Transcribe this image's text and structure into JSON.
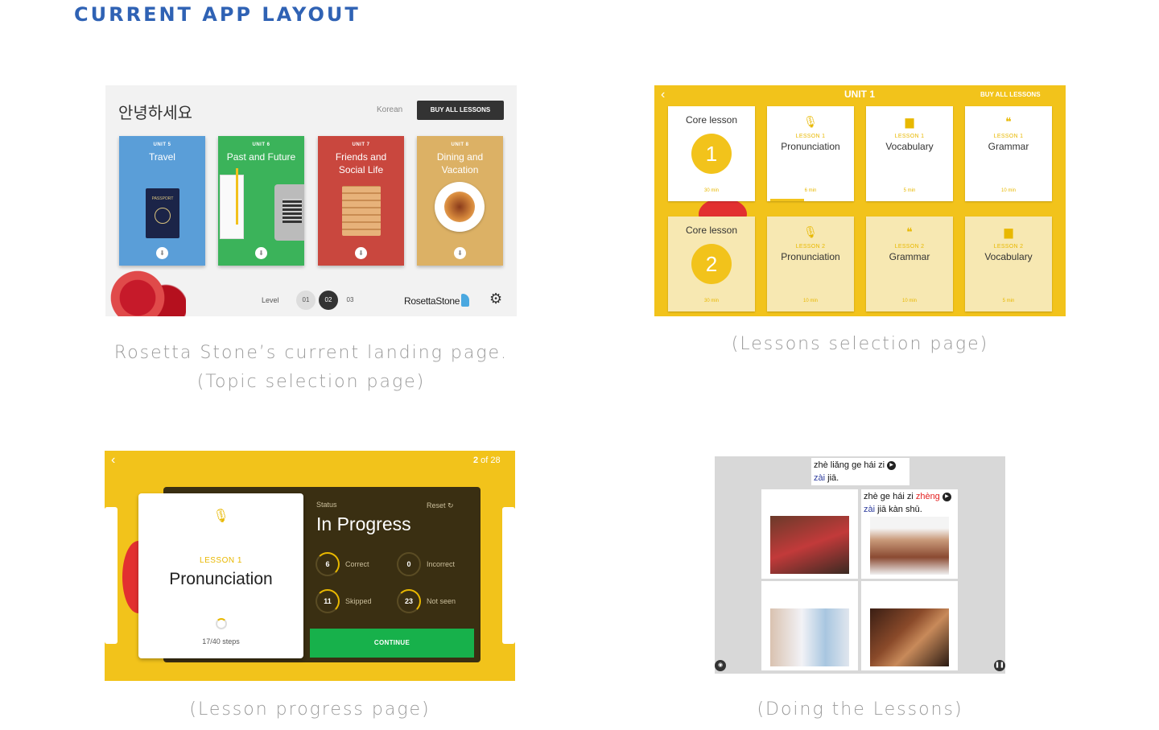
{
  "page_title": "CURRENT APP LAYOUT",
  "captions": {
    "landing_line1": "Rosetta Stone’s current landing page.",
    "landing_line2": "(Topic selection page)",
    "lessons": "(Lessons selection page)",
    "progress": "(Lesson progress page)",
    "doing": "(Doing the Lessons)"
  },
  "landing": {
    "greeting": "안녕하세요",
    "language": "Korean",
    "buy_button": "BUY ALL LESSONS",
    "units": [
      {
        "number": "UNIT 5",
        "title": "Travel",
        "color": "#5a9ed8"
      },
      {
        "number": "UNIT 6",
        "title": "Past and Future",
        "color": "#3bb35a"
      },
      {
        "number": "UNIT 7",
        "title": "Friends and Social Life",
        "color": "#c9473e"
      },
      {
        "number": "UNIT 8",
        "title": "Dining and Vacation",
        "color": "#dcb165"
      }
    ],
    "passport_text": "PASSPORT",
    "level_label": "Level",
    "levels": [
      "01",
      "02",
      "03"
    ],
    "selected_level": "02",
    "brand": "RosettaStone"
  },
  "lessons": {
    "unit_title": "UNIT 1",
    "buy_button": "BUY ALL LESSONS",
    "row1": [
      {
        "type": "core",
        "title": "Core lesson",
        "number": "1",
        "duration": "30 min"
      },
      {
        "icon": "microphone-icon",
        "sub": "LESSON 1",
        "name": "Pronunciation",
        "duration": "6 min"
      },
      {
        "icon": "book-icon",
        "sub": "LESSON 1",
        "name": "Vocabulary",
        "duration": "5 min"
      },
      {
        "icon": "quote-icon",
        "sub": "LESSON 1",
        "name": "Grammar",
        "duration": "10 min"
      }
    ],
    "row2": [
      {
        "type": "core",
        "title": "Core lesson",
        "number": "2",
        "duration": "30 min"
      },
      {
        "icon": "microphone-icon",
        "sub": "LESSON 2",
        "name": "Pronunciation",
        "duration": "10 min"
      },
      {
        "icon": "quote-icon",
        "sub": "LESSON 2",
        "name": "Grammar",
        "duration": "10 min"
      },
      {
        "icon": "book-icon",
        "sub": "LESSON 2",
        "name": "Vocabulary",
        "duration": "5 min"
      }
    ]
  },
  "progress": {
    "counter_current": "2",
    "counter_rest": " of 28",
    "lesson_label": "LESSON 1",
    "lesson_name": "Pronunciation",
    "steps": "17/40 steps",
    "status_label": "Status",
    "reset_label": "Reset",
    "status_value": "In Progress",
    "stats": [
      {
        "value": "6",
        "label": "Correct"
      },
      {
        "value": "0",
        "label": "Incorrect"
      },
      {
        "value": "11",
        "label": "Skipped"
      },
      {
        "value": "23",
        "label": "Not seen"
      }
    ],
    "continue_button": "CONTINUE"
  },
  "doing": {
    "prompt1_a": "zhè liǎng ge hái zi",
    "prompt1_b": "zài",
    "prompt1_c": " jiā.",
    "prompt2_a": "zhè ge hái zi ",
    "prompt2_red": "zhèng",
    "prompt2_b": "zài",
    "prompt2_c": " jiā kàn shū."
  }
}
